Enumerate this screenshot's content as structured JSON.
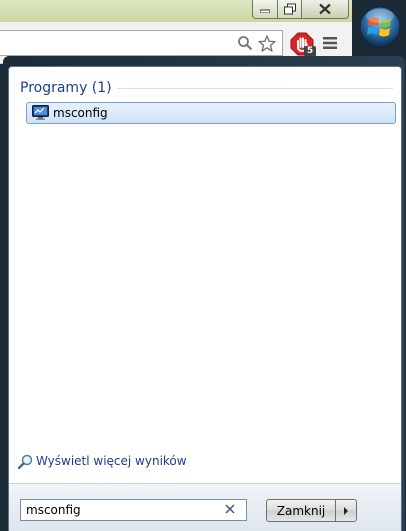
{
  "browser": {
    "extension_badge": "5"
  },
  "start_menu": {
    "results_header": "Programy (1)",
    "results": [
      {
        "label": "msconfig",
        "icon": "msconfig-icon"
      }
    ],
    "more_results_label": "Wyświetl więcej wyników",
    "search": {
      "value": "msconfig"
    },
    "shutdown_label": "Zamknij"
  },
  "colors": {
    "header_text": "#1e3f8c",
    "selection_border": "#7da2ce",
    "panel_dark": "#1b2b3a"
  }
}
